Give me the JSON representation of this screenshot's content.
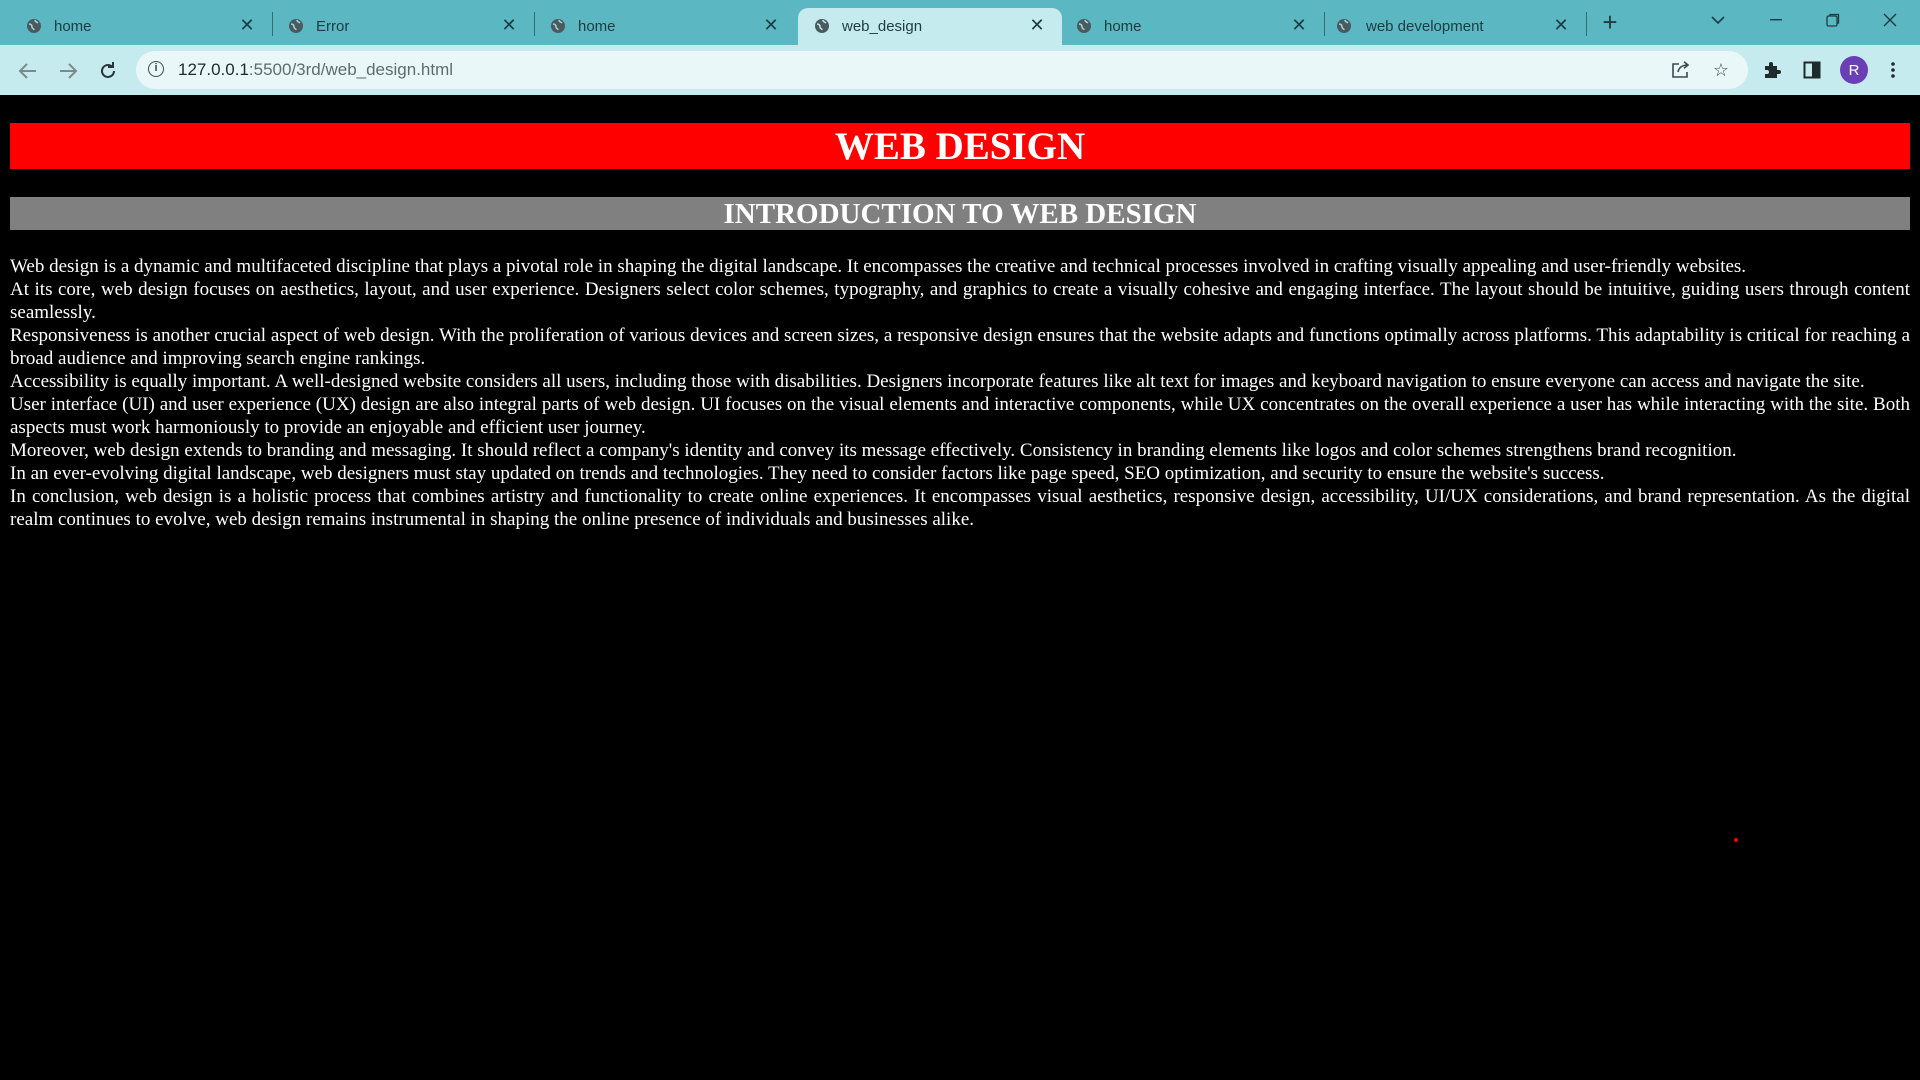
{
  "browser": {
    "tabs": [
      {
        "title": "home",
        "active": false
      },
      {
        "title": "Error",
        "active": false
      },
      {
        "title": "home",
        "active": false
      },
      {
        "title": "web_design",
        "active": true
      },
      {
        "title": "home",
        "active": false
      },
      {
        "title": "web development",
        "active": false
      }
    ],
    "url_host": "127.0.0.1",
    "url_path": ":5500/3rd/web_design.html",
    "profile_initial": "R",
    "icons": {
      "tab": "globe-icon",
      "close": "close-icon",
      "new_tab": "plus-icon",
      "tab_search": "chevron-down-icon",
      "minimize": "minimize-icon",
      "restore": "restore-icon",
      "window_close": "close-icon",
      "back": "arrow-left-icon",
      "forward": "arrow-right-icon",
      "reload": "reload-icon",
      "site_info": "info-icon",
      "share": "share-icon",
      "bookmark": "star-icon",
      "extensions": "puzzle-icon",
      "side_panel": "side-panel-icon",
      "menu": "kebab-menu-icon"
    },
    "colors": {
      "tabbar": "#5bb7c2",
      "toolbar": "#c5ebef",
      "avatar": "#6a3fb5"
    }
  },
  "page": {
    "title": "WEB DESIGN",
    "subtitle": "INTRODUCTION TO WEB DESIGN",
    "paragraphs": [
      "Web design is a dynamic and multifaceted discipline that plays a pivotal role in shaping the digital landscape. It encompasses the creative and technical processes involved in crafting visually appealing and user-friendly websites.",
      "At its core, web design focuses on aesthetics, layout, and user experience. Designers select color schemes, typography, and graphics to create a visually cohesive and engaging interface. The layout should be intuitive, guiding users through content seamlessly.",
      "Responsiveness is another crucial aspect of web design. With the proliferation of various devices and screen sizes, a responsive design ensures that the website adapts and functions optimally across platforms. This adaptability is critical for reaching a broad audience and improving search engine rankings.",
      "Accessibility is equally important. A well-designed website considers all users, including those with disabilities. Designers incorporate features like alt text for images and keyboard navigation to ensure everyone can access and navigate the site.",
      "User interface (UI) and user experience (UX) design are also integral parts of web design. UI focuses on the visual elements and interactive components, while UX concentrates on the overall experience a user has while interacting with the site. Both aspects must work harmoniously to provide an enjoyable and efficient user journey.",
      "Moreover, web design extends to branding and messaging. It should reflect a company's identity and convey its message effectively. Consistency in branding elements like logos and color schemes strengthens brand recognition.",
      "In an ever-evolving digital landscape, web designers must stay updated on trends and technologies. They need to consider factors like page speed, SEO optimization, and security to ensure the website's success.",
      "In conclusion, web design is a holistic process that combines artistry and functionality to create online experiences. It encompasses visual aesthetics, responsive design, accessibility, UI/UX considerations, and brand representation. As the digital realm continues to evolve, web design remains instrumental in shaping the online presence of individuals and businesses alike."
    ],
    "colors": {
      "background": "#000000",
      "title_bg": "#ff0000",
      "subtitle_bg": "#808080",
      "text": "#ffffff"
    }
  }
}
